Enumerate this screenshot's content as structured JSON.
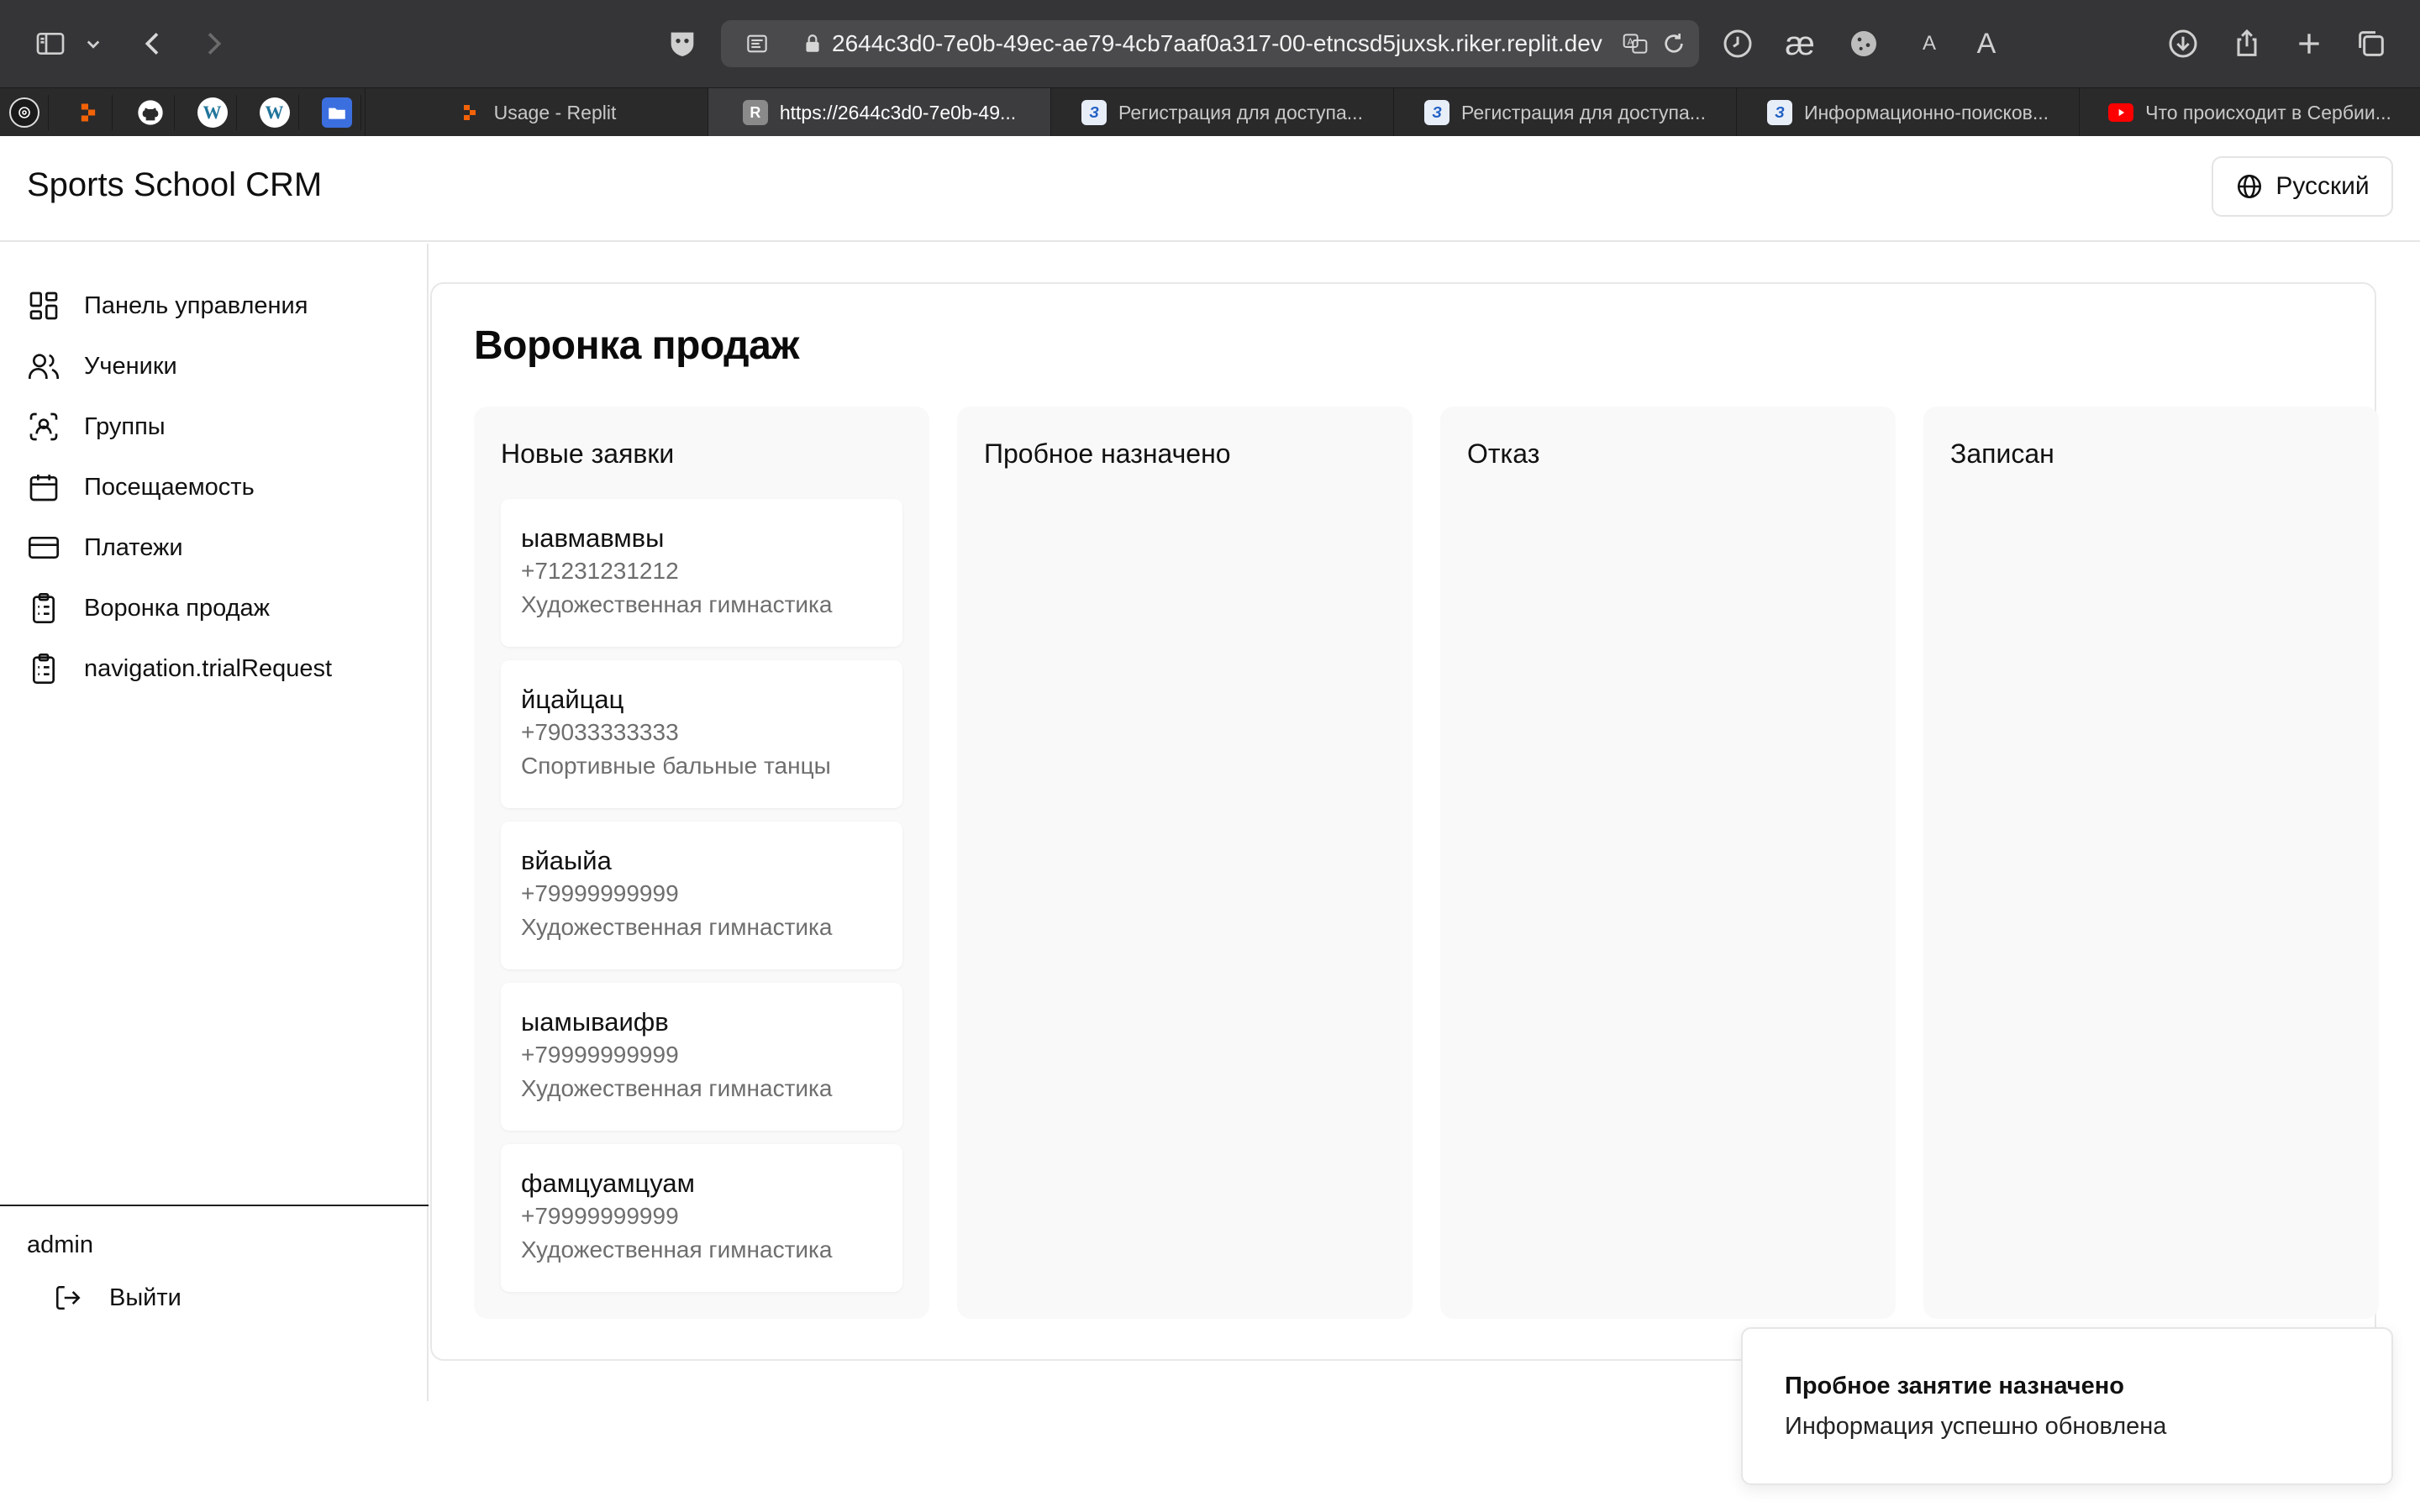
{
  "browser": {
    "url": "2644c3d0-7e0b-49ec-ae79-4cb7aaf0a317-00-etncsd5juxsk.riker.replit.dev",
    "icons": [
      "sidebar-icon",
      "chevron-down-icon",
      "back-icon",
      "forward-icon",
      "shield-icon",
      "reader-icon",
      "lock-icon",
      "translate-icon",
      "reload-icon",
      "history-icon",
      "ae-icon",
      "cookie-icon",
      "text-small-icon",
      "text-large-icon",
      "download-icon",
      "share-icon",
      "plus-icon",
      "tabs-icon"
    ],
    "text_small": "A",
    "text_large": "A",
    "ae_glyph": "æ",
    "pinned_tabs": [
      {
        "icon": "openai-icon"
      },
      {
        "icon": "replit-icon"
      },
      {
        "icon": "github-icon"
      },
      {
        "icon": "wordpress-icon"
      },
      {
        "icon": "wordpress-icon"
      },
      {
        "icon": "folder-icon"
      }
    ],
    "tabs": [
      {
        "title": "Usage - Replit",
        "icon": "replit-icon",
        "active": false
      },
      {
        "title": "https://2644c3d0-7e0b-49...",
        "icon": "r-icon",
        "fav_letter": "R",
        "active": true
      },
      {
        "title": "Регистрация для доступа...",
        "icon": "z-icon",
        "active": false
      },
      {
        "title": "Регистрация для доступа...",
        "icon": "z-icon",
        "active": false
      },
      {
        "title": "Информационно-поисков...",
        "icon": "z-icon",
        "active": false
      },
      {
        "title": "Что происходит в Сербии...",
        "icon": "youtube-icon",
        "active": false
      }
    ]
  },
  "app": {
    "title": "Sports School CRM",
    "language_button": "Русский"
  },
  "sidebar": {
    "items": [
      {
        "label": "Панель управления",
        "icon": "dashboard-icon"
      },
      {
        "label": "Ученики",
        "icon": "users-icon"
      },
      {
        "label": "Группы",
        "icon": "group-scan-icon"
      },
      {
        "label": "Посещаемость",
        "icon": "calendar-icon"
      },
      {
        "label": "Платежи",
        "icon": "credit-card-icon"
      },
      {
        "label": "Воронка продаж",
        "icon": "clipboard-icon"
      },
      {
        "label": "navigation.trialRequest",
        "icon": "clipboard-icon"
      }
    ],
    "user": "admin",
    "logout_label": "Выйти"
  },
  "main": {
    "title": "Воронка продаж",
    "columns": [
      {
        "title": "Новые заявки",
        "cards": [
          {
            "name": "ыавмавмвы",
            "phone": "+71231231212",
            "sport": "Художественная гимнастика"
          },
          {
            "name": "йцайцац",
            "phone": "+79033333333",
            "sport": "Спортивные бальные танцы"
          },
          {
            "name": "вйаыйа",
            "phone": "+79999999999",
            "sport": "Художественная гимнастика"
          },
          {
            "name": "ыамываифв",
            "phone": "+79999999999",
            "sport": "Художественная гимнастика"
          },
          {
            "name": "фамцуамцуам",
            "phone": "+79999999999",
            "sport": "Художественная гимнастика"
          }
        ]
      },
      {
        "title": "Пробное назначено",
        "cards": []
      },
      {
        "title": "Отказ",
        "cards": []
      },
      {
        "title": "Записан",
        "cards": []
      }
    ]
  },
  "toast": {
    "title": "Пробное занятие назначено",
    "description": "Информация успешно обновлена"
  },
  "colors": {
    "chrome_bg": "#353537",
    "tabbar_bg": "#2a2a2b",
    "column_bg": "#f9f9f9",
    "muted_text": "#6e6e6e"
  }
}
